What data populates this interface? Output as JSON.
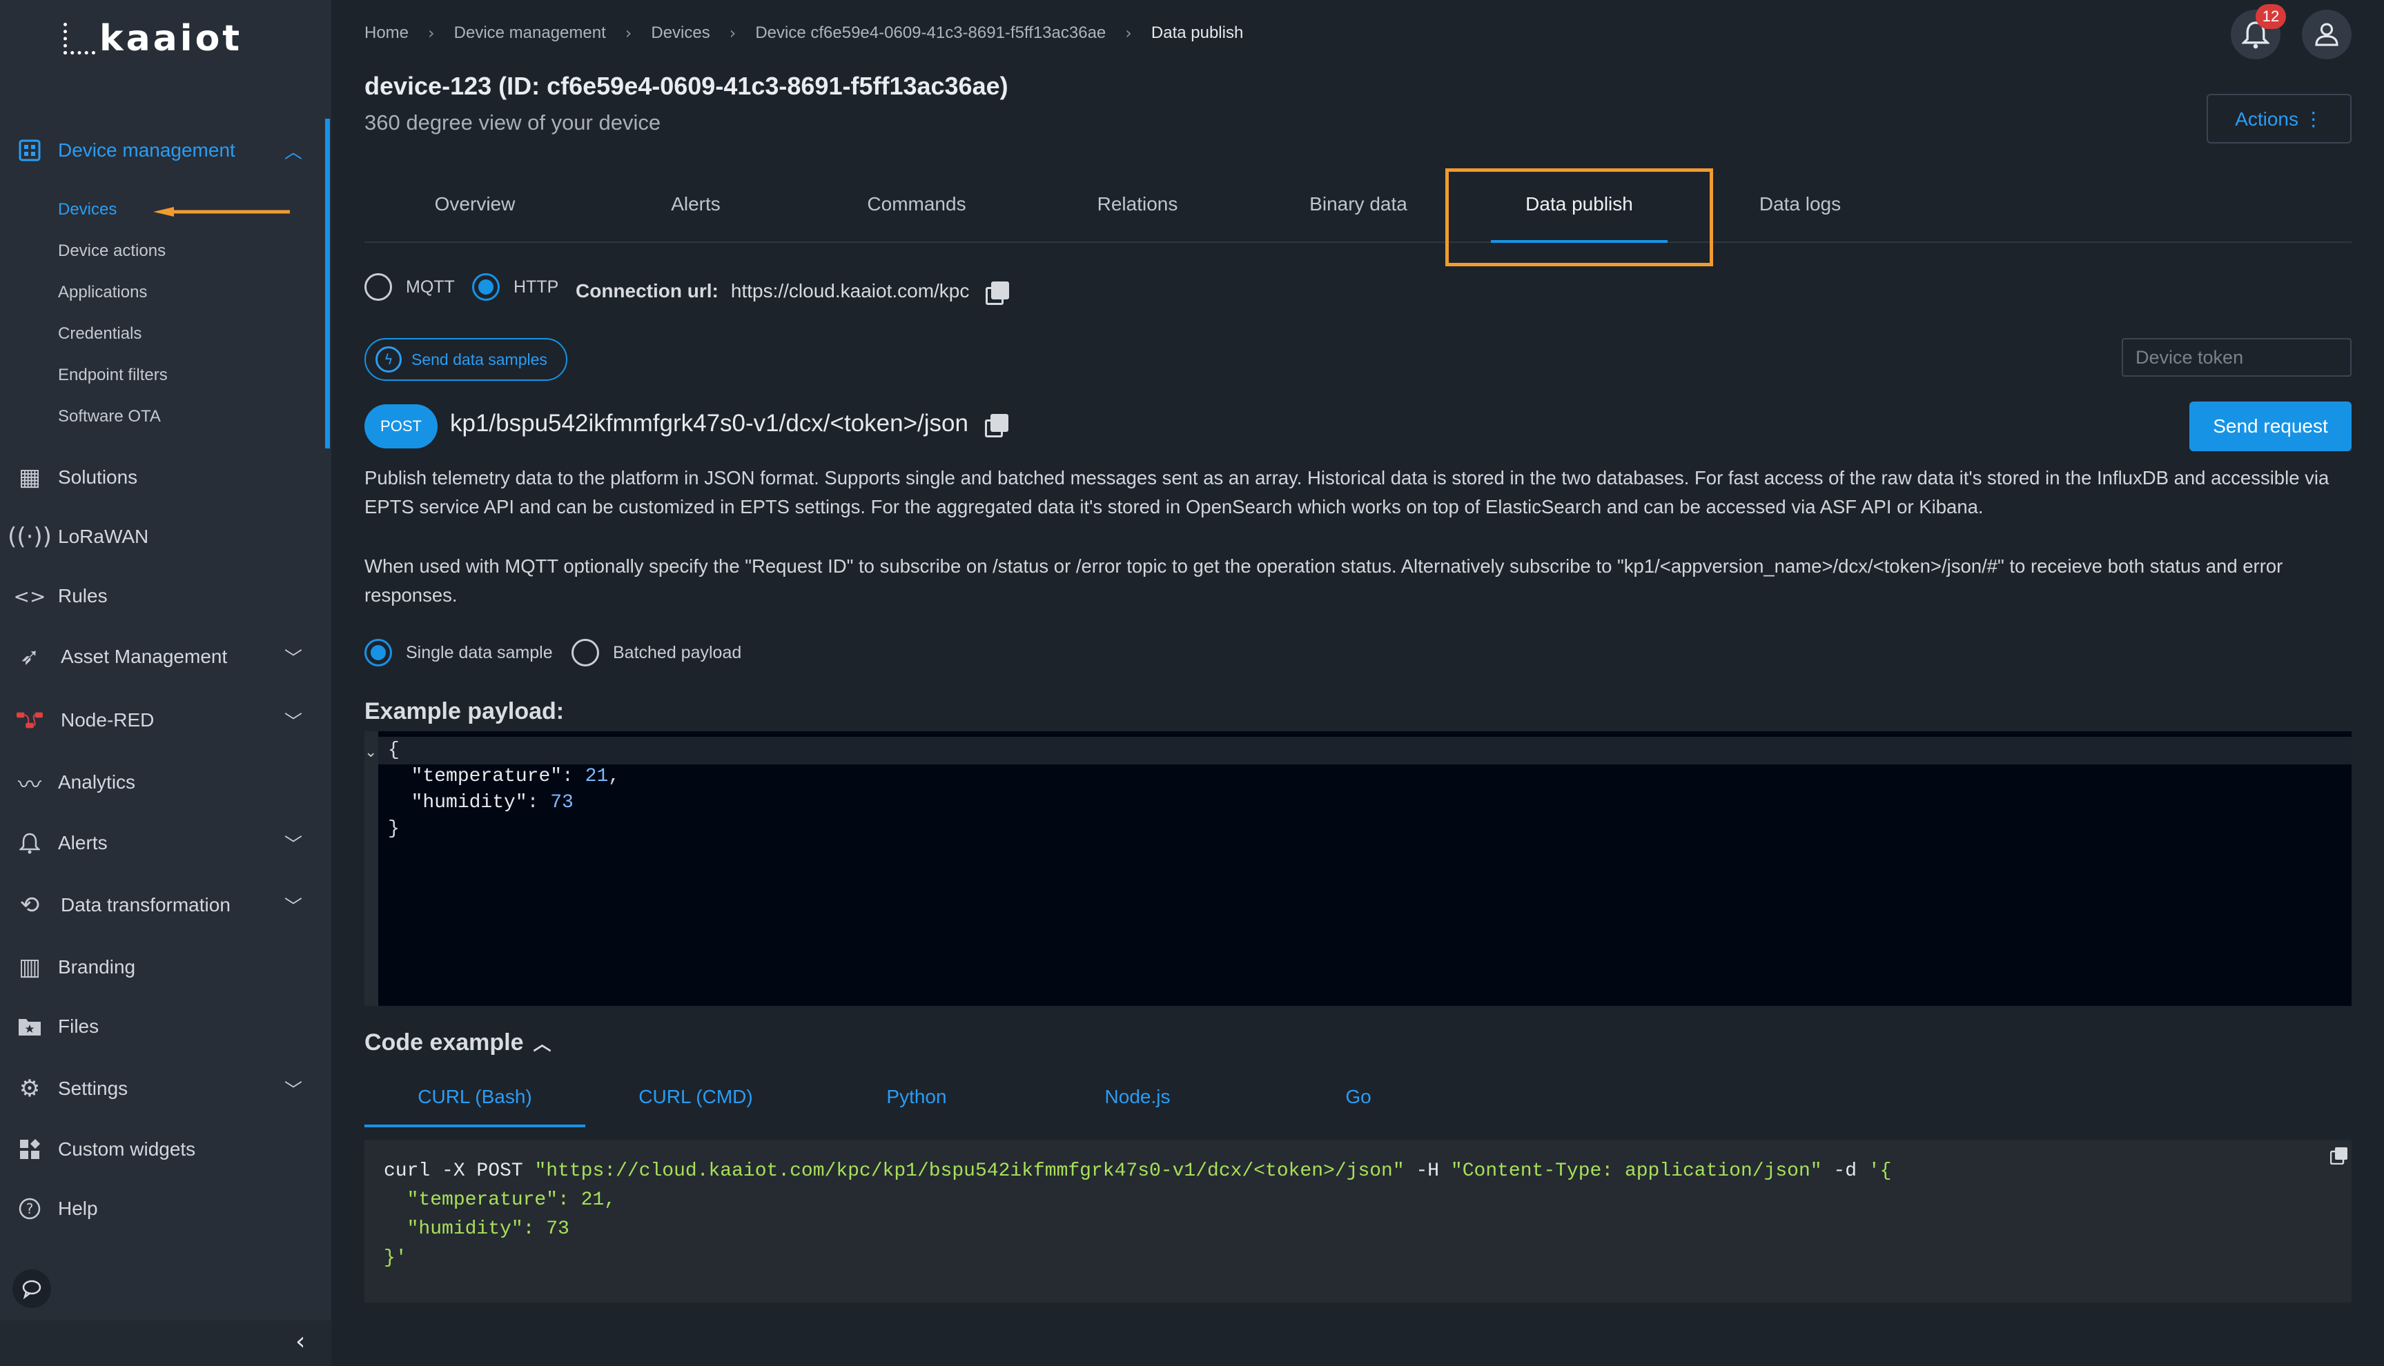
{
  "brand": {
    "name": "kaaiot"
  },
  "sidebar": {
    "device_management": {
      "label": "Device management",
      "items": [
        {
          "label": "Devices"
        },
        {
          "label": "Device actions"
        },
        {
          "label": "Applications"
        },
        {
          "label": "Credentials"
        },
        {
          "label": "Endpoint filters"
        },
        {
          "label": "Software OTA"
        }
      ]
    },
    "items": [
      {
        "label": "Solutions"
      },
      {
        "label": "LoRaWAN"
      },
      {
        "label": "Rules"
      },
      {
        "label": "Asset Management"
      },
      {
        "label": "Node-RED"
      },
      {
        "label": "Analytics"
      },
      {
        "label": "Alerts"
      },
      {
        "label": "Data transformation"
      },
      {
        "label": "Branding"
      },
      {
        "label": "Files"
      },
      {
        "label": "Settings"
      },
      {
        "label": "Custom widgets"
      },
      {
        "label": "Help"
      }
    ]
  },
  "breadcrumbs": [
    "Home",
    "Device management",
    "Devices",
    "Device cf6e59e4-0609-41c3-8691-f5ff13ac36ae",
    "Data publish"
  ],
  "header": {
    "notifications_count": "12",
    "title": "device-123 (ID: cf6e59e4-0609-41c3-8691-f5ff13ac36ae)",
    "subtitle": "360 degree view of your device",
    "actions_label": "Actions ⋮"
  },
  "tabs": [
    "Overview",
    "Alerts",
    "Commands",
    "Relations",
    "Binary data",
    "Data publish",
    "Data logs"
  ],
  "protocol": {
    "options": [
      "MQTT",
      "HTTP"
    ],
    "selected": "HTTP",
    "connection_label": "Connection url:",
    "connection_url": "https://cloud.kaaiot.com/kpc"
  },
  "send_samples_label": "Send data samples",
  "device_token": {
    "placeholder": "Device token",
    "value": ""
  },
  "request": {
    "method": "POST",
    "path": "kp1/bspu542ikfmmfgrk47s0-v1/dcx/<token>/json",
    "send_label": "Send request"
  },
  "description": [
    "Publish telemetry data to the platform in JSON format. Supports single and batched messages sent as an array. Historical data is stored in the two databases. For fast access of the raw data it's stored in the InfluxDB and accessible via EPTS service API and can be customized in EPTS settings. For the aggregated data it's stored in OpenSearch which works on top of ElasticSearch and can be accessed via ASF API or Kibana.",
    "When used with MQTT optionally specify the \"Request ID\" to subscribe on /status or /error topic to get the operation status. Alternatively subscribe to \"kp1/<appversion_name>/dcx/<token>/json/#\" to receieve both status and error responses."
  ],
  "payload_mode": {
    "options": [
      "Single data sample",
      "Batched payload"
    ],
    "selected": "Single data sample"
  },
  "example_payload": {
    "title": "Example payload:",
    "open": "{",
    "fields": [
      {
        "key": "\"temperature\"",
        "value": "21",
        "trail": ","
      },
      {
        "key": "\"humidity\"",
        "value": "73",
        "trail": ""
      }
    ],
    "close": "}"
  },
  "code_example": {
    "title": "Code example",
    "tabs": [
      "CURL (Bash)",
      "CURL (CMD)",
      "Python",
      "Node.js",
      "Go"
    ],
    "selected": "CURL (Bash)",
    "cmd": "curl -X POST",
    "url": "\"https://cloud.kaaiot.com/kpc/kp1/bspu542ikfmmfgrk47s0-v1/dcx/<token>/json\"",
    "header_flag": "-H",
    "header": "\"Content-Type: application/json\"",
    "data_flag": "-d",
    "data_open": "'{",
    "line2": "  \"temperature\": 21,",
    "line3": "  \"humidity\": 73",
    "data_close": "}'"
  },
  "colors": {
    "accent": "#1793e6",
    "highlight": "#f29b2f",
    "badge": "#d83a3a"
  }
}
